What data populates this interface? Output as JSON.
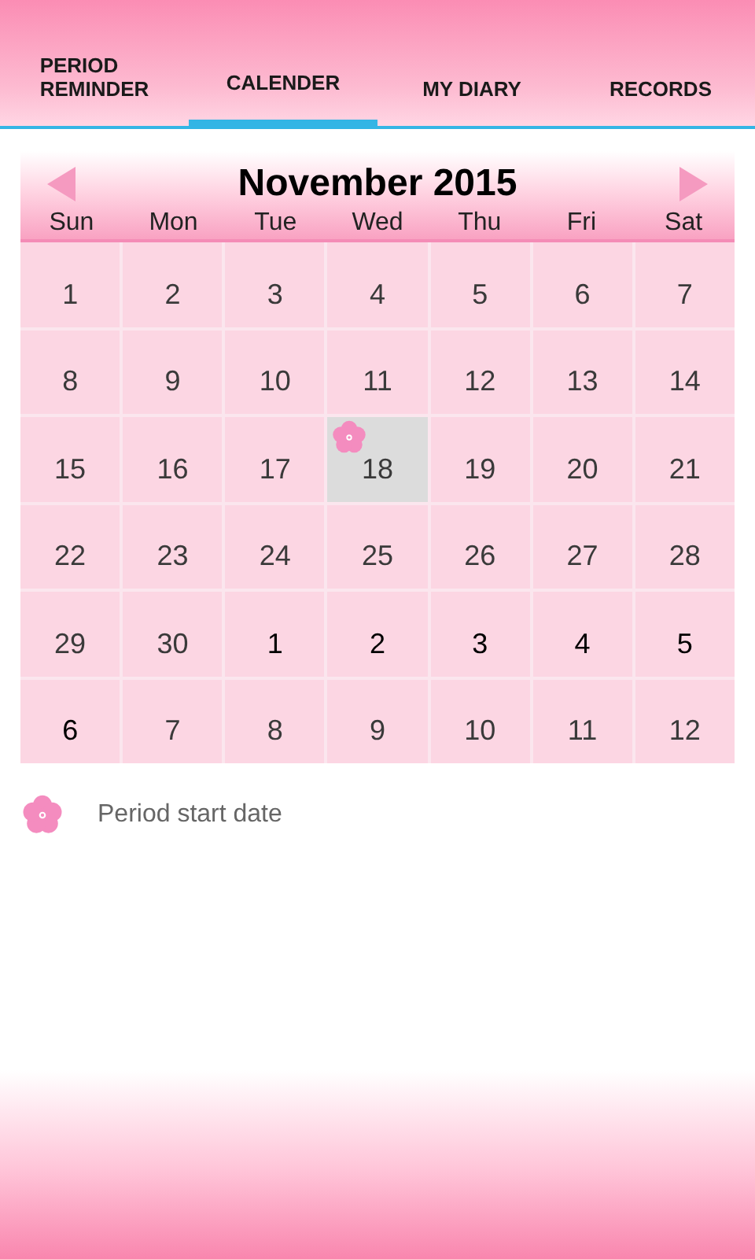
{
  "tabs": [
    {
      "label": "PERIOD\nREMINDER",
      "selected": false
    },
    {
      "label": "CALENDER",
      "selected": true
    },
    {
      "label": "MY DIARY",
      "selected": false
    },
    {
      "label": "RECORDS",
      "selected": false
    }
  ],
  "calendar": {
    "title": "November 2015",
    "weekdays": [
      "Sun",
      "Mon",
      "Tue",
      "Wed",
      "Thu",
      "Fri",
      "Sat"
    ],
    "weeks": [
      [
        {
          "day": "1",
          "selected": false,
          "dark": false,
          "period_start": false
        },
        {
          "day": "2",
          "selected": false,
          "dark": false,
          "period_start": false
        },
        {
          "day": "3",
          "selected": false,
          "dark": false,
          "period_start": false
        },
        {
          "day": "4",
          "selected": false,
          "dark": false,
          "period_start": false
        },
        {
          "day": "5",
          "selected": false,
          "dark": false,
          "period_start": false
        },
        {
          "day": "6",
          "selected": false,
          "dark": false,
          "period_start": false
        },
        {
          "day": "7",
          "selected": false,
          "dark": false,
          "period_start": false
        }
      ],
      [
        {
          "day": "8",
          "selected": false,
          "dark": false,
          "period_start": false
        },
        {
          "day": "9",
          "selected": false,
          "dark": false,
          "period_start": false
        },
        {
          "day": "10",
          "selected": false,
          "dark": false,
          "period_start": false
        },
        {
          "day": "11",
          "selected": false,
          "dark": false,
          "period_start": false
        },
        {
          "day": "12",
          "selected": false,
          "dark": false,
          "period_start": false
        },
        {
          "day": "13",
          "selected": false,
          "dark": false,
          "period_start": false
        },
        {
          "day": "14",
          "selected": false,
          "dark": false,
          "period_start": false
        }
      ],
      [
        {
          "day": "15",
          "selected": false,
          "dark": false,
          "period_start": false
        },
        {
          "day": "16",
          "selected": false,
          "dark": false,
          "period_start": false
        },
        {
          "day": "17",
          "selected": false,
          "dark": false,
          "period_start": false
        },
        {
          "day": "18",
          "selected": true,
          "dark": false,
          "period_start": true
        },
        {
          "day": "19",
          "selected": false,
          "dark": false,
          "period_start": false
        },
        {
          "day": "20",
          "selected": false,
          "dark": false,
          "period_start": false
        },
        {
          "day": "21",
          "selected": false,
          "dark": false,
          "period_start": false
        }
      ],
      [
        {
          "day": "22",
          "selected": false,
          "dark": false,
          "period_start": false
        },
        {
          "day": "23",
          "selected": false,
          "dark": false,
          "period_start": false
        },
        {
          "day": "24",
          "selected": false,
          "dark": false,
          "period_start": false
        },
        {
          "day": "25",
          "selected": false,
          "dark": false,
          "period_start": false
        },
        {
          "day": "26",
          "selected": false,
          "dark": false,
          "period_start": false
        },
        {
          "day": "27",
          "selected": false,
          "dark": false,
          "period_start": false
        },
        {
          "day": "28",
          "selected": false,
          "dark": false,
          "period_start": false
        }
      ],
      [
        {
          "day": "29",
          "selected": false,
          "dark": false,
          "period_start": false
        },
        {
          "day": "30",
          "selected": false,
          "dark": false,
          "period_start": false
        },
        {
          "day": "1",
          "selected": false,
          "dark": true,
          "period_start": false
        },
        {
          "day": "2",
          "selected": false,
          "dark": true,
          "period_start": false
        },
        {
          "day": "3",
          "selected": false,
          "dark": true,
          "period_start": false
        },
        {
          "day": "4",
          "selected": false,
          "dark": true,
          "period_start": false
        },
        {
          "day": "5",
          "selected": false,
          "dark": true,
          "period_start": false
        }
      ],
      [
        {
          "day": "6",
          "selected": false,
          "dark": true,
          "period_start": false
        },
        {
          "day": "7",
          "selected": false,
          "dark": false,
          "period_start": false
        },
        {
          "day": "8",
          "selected": false,
          "dark": false,
          "period_start": false
        },
        {
          "day": "9",
          "selected": false,
          "dark": false,
          "period_start": false
        },
        {
          "day": "10",
          "selected": false,
          "dark": false,
          "period_start": false
        },
        {
          "day": "11",
          "selected": false,
          "dark": false,
          "period_start": false
        },
        {
          "day": "12",
          "selected": false,
          "dark": false,
          "period_start": false
        }
      ]
    ]
  },
  "legend": {
    "label": "Period start date"
  }
}
